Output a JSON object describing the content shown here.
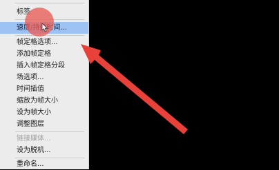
{
  "menu": {
    "items": [
      {
        "label": "标签",
        "state": "normal"
      },
      {
        "label": "速度/持续时间...",
        "state": "highlight"
      },
      {
        "label": "帧定格选项...",
        "state": "normal"
      },
      {
        "label": "添加帧定格",
        "state": "normal"
      },
      {
        "label": "插入帧定格分段",
        "state": "normal"
      },
      {
        "label": "场选项...",
        "state": "normal"
      },
      {
        "label": "时间插值",
        "state": "normal"
      },
      {
        "label": "缩放为帧大小",
        "state": "normal"
      },
      {
        "label": "设为帧大小",
        "state": "normal"
      },
      {
        "label": "调整图层",
        "state": "normal"
      },
      {
        "label": "链接媒体...",
        "state": "disabled"
      },
      {
        "label": "设为脱机...",
        "state": "normal"
      },
      {
        "label": "重命名...",
        "state": "normal"
      }
    ]
  },
  "annotation": {
    "arrow_color": "#e8413a",
    "highlight_circle_color": "#e85c56"
  },
  "colors": {
    "background": "#000000",
    "menu_background": "#ececec",
    "highlight": "#9cc3f4"
  }
}
